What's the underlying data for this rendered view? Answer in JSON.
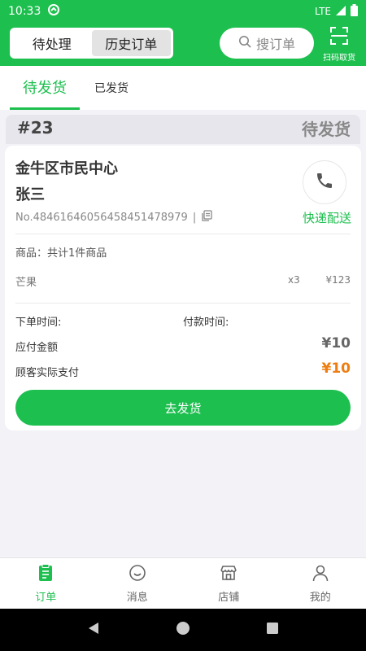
{
  "status_bar": {
    "time": "10:33",
    "network": "LTE"
  },
  "header": {
    "seg_tabs": [
      {
        "label": "待处理",
        "active": true
      },
      {
        "label": "历史订单",
        "active": false
      }
    ],
    "search_placeholder": "搜订单",
    "scan_label": "扫码取货",
    "accent_color": "#1dbf4f"
  },
  "sub_tabs": [
    {
      "label": "待发货",
      "active": true
    },
    {
      "label": "已发货",
      "active": false
    }
  ],
  "order": {
    "number": "#23",
    "status": "待发货",
    "address": "金牛区市民中心",
    "customer": "张三",
    "order_no": "No.4846164605645845147897​9",
    "separator": "|",
    "delivery_type": "快递配送",
    "goods_label": "商品：共计1件商品",
    "items": [
      {
        "name": "芒果",
        "qty": "x3",
        "price": "¥123"
      }
    ],
    "order_time_label": "下单时间:",
    "pay_time_label": "付款时间:",
    "payable_label": "应付金额",
    "payable_value": "¥10",
    "actual_label": "顾客实际支付",
    "actual_value": "¥10",
    "ship_button": "去发货",
    "highlight_color": "#ee7d12"
  },
  "bottom_nav": [
    {
      "label": "订单",
      "icon": "clipboard-icon",
      "active": true
    },
    {
      "label": "消息",
      "icon": "chat-icon",
      "active": false
    },
    {
      "label": "店铺",
      "icon": "store-icon",
      "active": false
    },
    {
      "label": "我的",
      "icon": "user-icon",
      "active": false
    }
  ]
}
